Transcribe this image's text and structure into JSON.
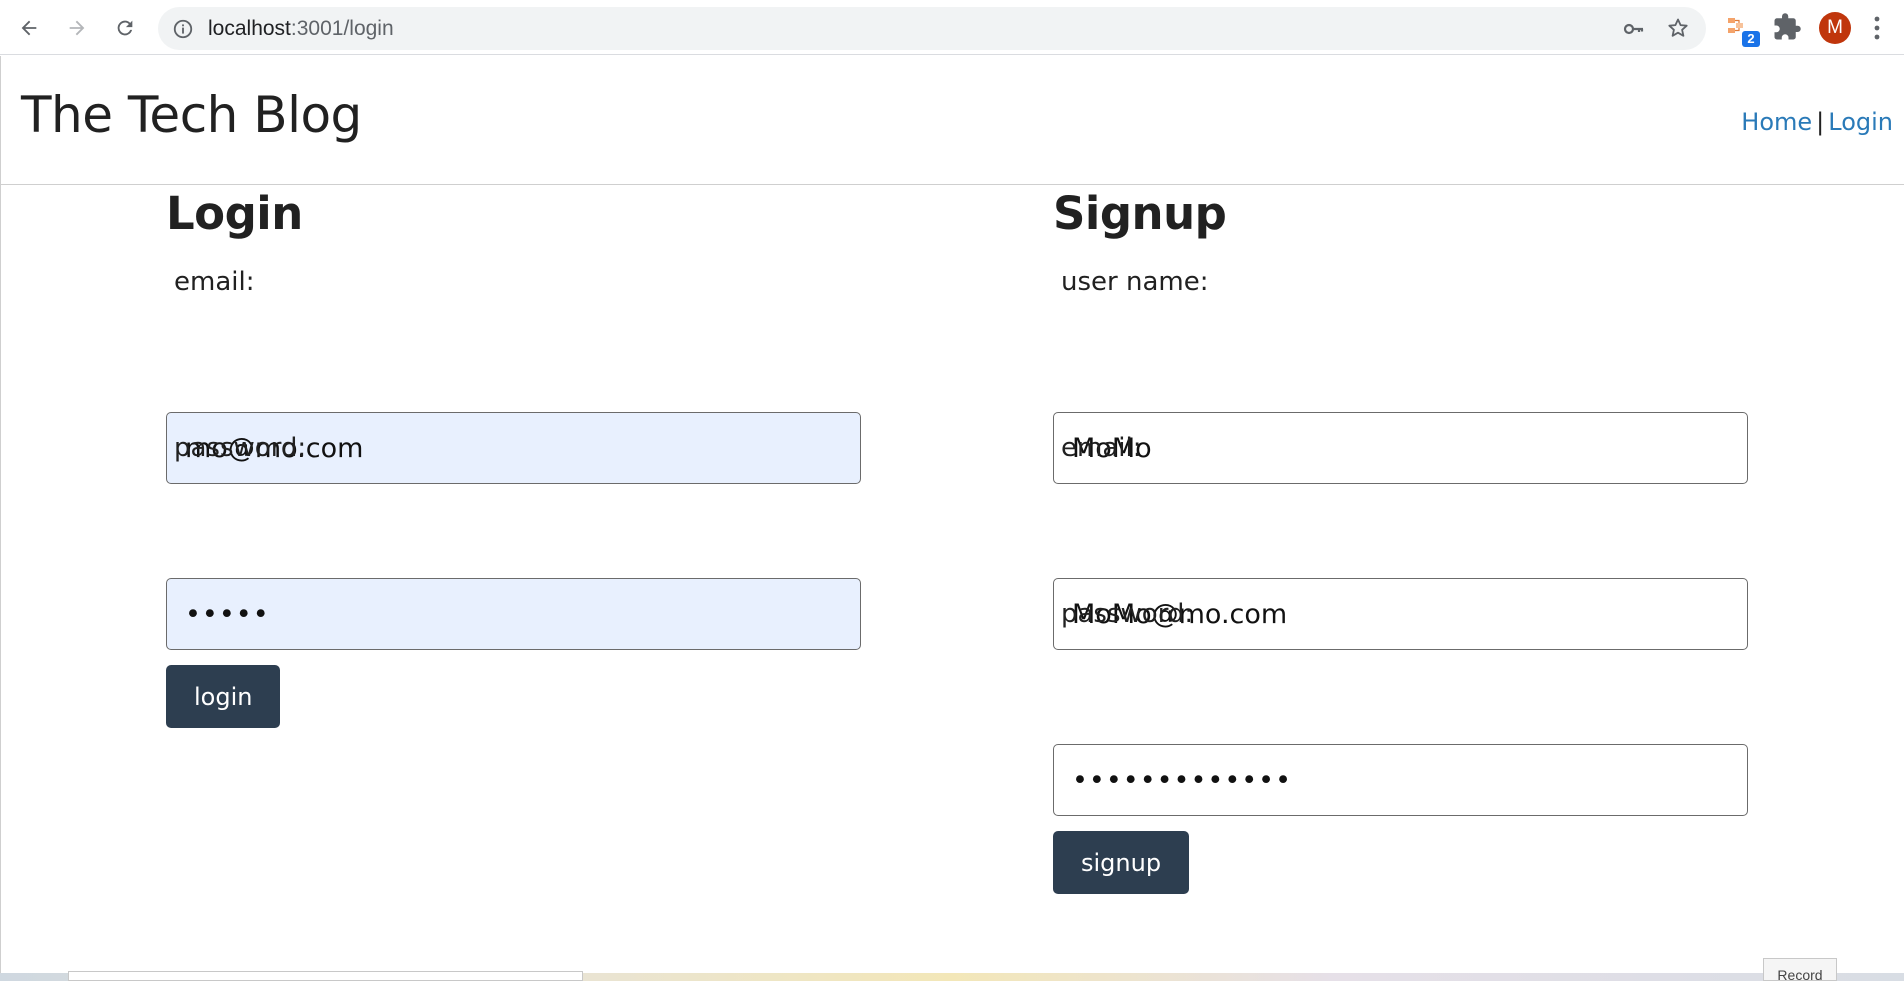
{
  "browser": {
    "url_host": "localhost",
    "url_path": ":3001/login",
    "extension_badge": "2",
    "profile_initial": "M",
    "icons": [
      "back-arrow-icon",
      "forward-arrow-icon",
      "reload-icon",
      "site-info-icon",
      "key-icon",
      "star-icon",
      "extension-icon",
      "puzzle-icon",
      "kebab-menu-icon"
    ]
  },
  "site": {
    "title": "The Tech Blog",
    "nav": {
      "home": "Home",
      "separator": "|",
      "login": "Login"
    }
  },
  "login_form": {
    "title": "Login",
    "email_label": "email:",
    "email_value": "mo@mo.com",
    "password_label": "password:",
    "password_value": "•••••",
    "button_label": "login"
  },
  "signup_form": {
    "title": "Signup",
    "username_label": "user name:",
    "username_value": "MoMo",
    "email_label": "email:",
    "email_value": "MoMo@mo.com",
    "password_label": "password:",
    "password_value": "•••••••••••••",
    "button_label": "signup"
  },
  "taskbar": {
    "partial_label": "Record"
  },
  "colors": {
    "link": "#2a7ab8",
    "button_bg": "#2d3e50",
    "autofill_bg": "#e8f0fe",
    "avatar_bg": "#c0360c"
  }
}
